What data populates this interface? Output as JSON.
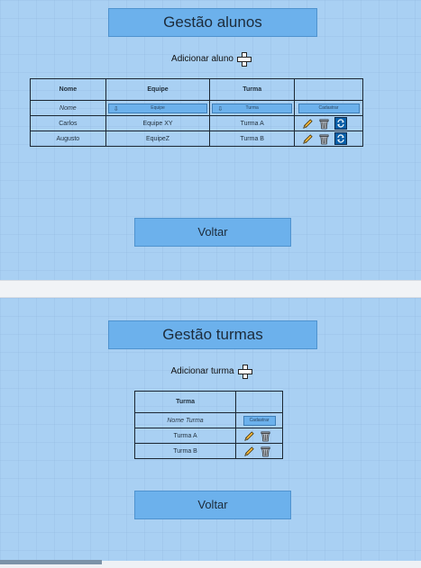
{
  "students": {
    "title": "Gestão alunos",
    "add_label": "Adicionar aluno",
    "headers": [
      "Nome",
      "Equipe",
      "Turma",
      ""
    ],
    "form": {
      "name_placeholder": "Nome",
      "team_select": "Equipe",
      "class_select": "Turma",
      "submit_label": "Cadastrar"
    },
    "rows": [
      {
        "name": "Carlos",
        "team": "Equipe XY",
        "class": "Turma A"
      },
      {
        "name": "Augusto",
        "team": "EquipeZ",
        "class": "Turma B"
      }
    ],
    "back_label": "Voltar"
  },
  "classes": {
    "title": "Gestão turmas",
    "add_label": "Adicionar turma",
    "headers": [
      "Turma",
      ""
    ],
    "form": {
      "name_placeholder": "Nome Turma",
      "submit_label": "Cadastrar"
    },
    "rows": [
      {
        "name": "Turma A"
      },
      {
        "name": "Turma B"
      }
    ],
    "back_label": "Voltar"
  },
  "icons": {
    "add": "plus-icon",
    "edit": "pencil-icon",
    "delete": "trash-icon",
    "change": "sync-icon",
    "select": "arrow-icon"
  },
  "colors": {
    "panel_bg": "#a9d0f3",
    "button_bg": "#6cb1ec",
    "sync_bg": "#0a5fa8"
  }
}
